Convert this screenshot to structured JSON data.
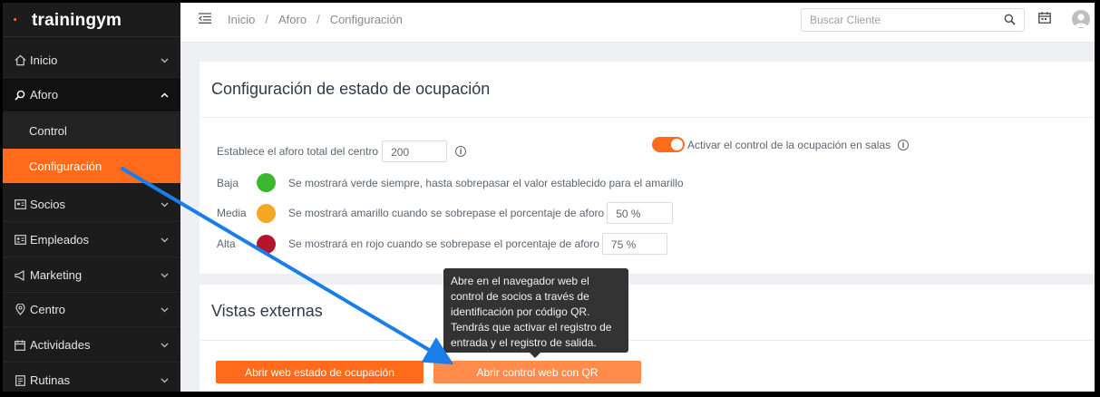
{
  "brand": {
    "logo_text": "trainingym"
  },
  "sidebar": {
    "items": [
      {
        "label": "Inicio",
        "icon": "home-icon"
      },
      {
        "label": "Aforo",
        "icon": "search-icon"
      },
      {
        "label": "Socios",
        "icon": "id-card-icon"
      },
      {
        "label": "Empleados",
        "icon": "badge-icon"
      },
      {
        "label": "Marketing",
        "icon": "megaphone-icon"
      },
      {
        "label": "Centro",
        "icon": "location-pin-icon"
      },
      {
        "label": "Actividades",
        "icon": "calendar-icon"
      },
      {
        "label": "Rutinas",
        "icon": "clipboard-icon"
      }
    ],
    "subitems": [
      {
        "label": "Control"
      },
      {
        "label": "Configuración"
      }
    ]
  },
  "topbar": {
    "breadcrumb": [
      "Inicio",
      "Aforo",
      "Configuración"
    ],
    "separator": "/",
    "search_placeholder": "Buscar Cliente"
  },
  "config": {
    "title": "Configuración de estado de ocupación",
    "total_label": "Establece el aforo total del centro",
    "total_value": "200",
    "toggle_label": "Activar el control de la ocupación en salas",
    "toggle_on": true,
    "levels": [
      {
        "name": "Baja",
        "color": "#3cb82e",
        "text": "Se mostrará verde siempre, hasta sobrepasar el valor establecido para el amarillo",
        "value": ""
      },
      {
        "name": "Media",
        "color": "#f5a623",
        "text": "Se mostrará amarillo cuando se sobrepase el porcentaje de aforo",
        "value": "50 %"
      },
      {
        "name": "Alta",
        "color": "#b5152b",
        "text": "Se mostrará en rojo cuando se sobrepase el porcentaje de aforo",
        "value": "75 %"
      }
    ]
  },
  "external": {
    "title": "Vistas externas",
    "button1": "Abrir web estado de ocupación",
    "button2": "Abrir control web con QR",
    "tooltip": "Abre en el navegador web el control de socios a través de identificación por código QR. Tendrás que activar el registro de entrada y el registro de salida."
  },
  "colors": {
    "accent": "#ff6b1a",
    "sidebar_bg": "#1c1c1c",
    "annotation_arrow": "#1a7de8"
  }
}
